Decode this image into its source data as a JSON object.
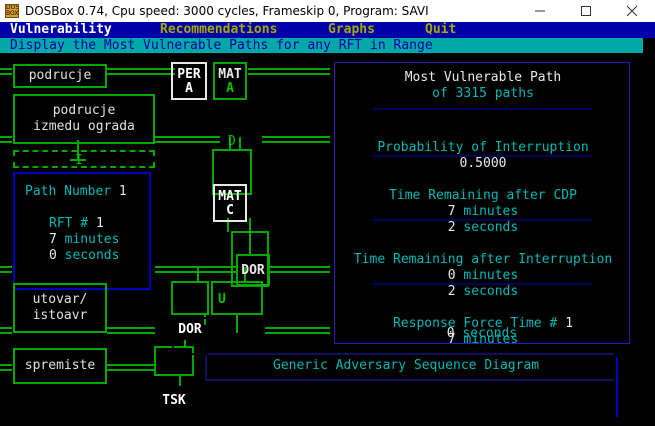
{
  "window": {
    "title": "DOSBox 0.74, Cpu speed:    3000 cycles, Frameskip  0, Program:    SAVI",
    "icon_label": "DOS BOX",
    "minimize_icon": "minimize-icon",
    "maximize_icon": "maximize-icon",
    "close_icon": "close-icon"
  },
  "menu": {
    "vulnerability": "Vulnerability",
    "recommendations": "Recommendations",
    "graphs": "Graphs",
    "quit": "Quit"
  },
  "status": "Display the Most Vulnerable Paths for any RFT in Range",
  "facilities": {
    "podrucje": "podrucje",
    "podrucje2_line1": "podrucje",
    "podrucje2_line2": "izmedu ograda",
    "utovar_line1": "utovar/",
    "utovar_line2": "istoavr",
    "spremiste": "spremiste"
  },
  "path_box": {
    "path_number_label": "Path Number",
    "path_number": "1",
    "rft_label": "RFT #",
    "rft_value": "1",
    "minutes_value": "7",
    "minutes_label": "minutes",
    "seconds_value": "0",
    "seconds_label": "seconds"
  },
  "panel": {
    "title": "Most Vulnerable Path",
    "of_label": "of",
    "path_count": "3315",
    "paths_label": "paths",
    "prob_title": "Probability of Interruption",
    "prob_value": "0.5000",
    "cdp_title": "Time Remaining after CDP",
    "cdp_minutes": "7",
    "cdp_seconds": "2",
    "interrupt_title": "Time Remaining after Interruption",
    "int_minutes": "0",
    "int_seconds": "2",
    "rft_title": "Response Force Time #",
    "rft_number": "1",
    "rft_minutes": "7",
    "rft_seconds": "0",
    "minutes_label": "minutes",
    "seconds_label": "seconds"
  },
  "diagram": {
    "title": "Generic Adversary Sequence Diagram",
    "gates": {
      "per": "PER",
      "mat1": "MAT",
      "mat2": "MAT",
      "dor1": "DOR",
      "dor2": "DOR",
      "tsk": "TSK"
    },
    "labels": {
      "a1": "A",
      "a2": "A",
      "c": "C",
      "u": "U",
      "d": "D",
      "i": "I"
    }
  },
  "colors": {
    "menu_bg": "#0000a8",
    "status_bg": "#00a8a8",
    "green": "#00c000",
    "cyan": "#00b8b8",
    "blue_border": "#0000c0"
  }
}
